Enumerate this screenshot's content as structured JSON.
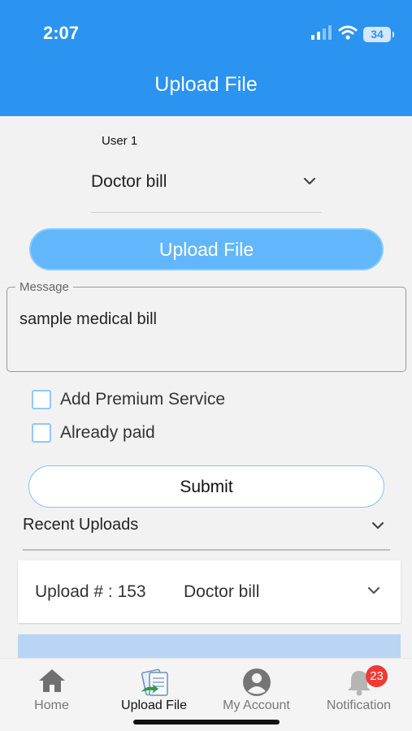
{
  "status_bar": {
    "time": "2:07",
    "battery": "34"
  },
  "header": {
    "title": "Upload File"
  },
  "form": {
    "user_label": "User 1",
    "document_type": "Doctor bill",
    "upload_button": "Upload File",
    "message_label": "Message",
    "message_value": "sample medical bill",
    "options": [
      {
        "label": "Add Premium Service",
        "checked": false
      },
      {
        "label": "Already paid",
        "checked": false
      }
    ],
    "submit_button": "Submit"
  },
  "recent_uploads": {
    "title": "Recent Uploads",
    "items": [
      {
        "id_label": "Upload # : 153",
        "type": "Doctor bill"
      }
    ]
  },
  "bottom_nav": {
    "items": [
      {
        "label": "Home",
        "icon": "home-icon",
        "active": false
      },
      {
        "label": "Upload File",
        "icon": "upload-file-icon",
        "active": true
      },
      {
        "label": "My Account",
        "icon": "account-icon",
        "active": false
      },
      {
        "label": "Notification",
        "icon": "bell-icon",
        "active": false,
        "badge": "23"
      }
    ]
  },
  "colors": {
    "primary": "#2b93f0",
    "button": "#62b6fb",
    "badge": "#ee3b34"
  }
}
